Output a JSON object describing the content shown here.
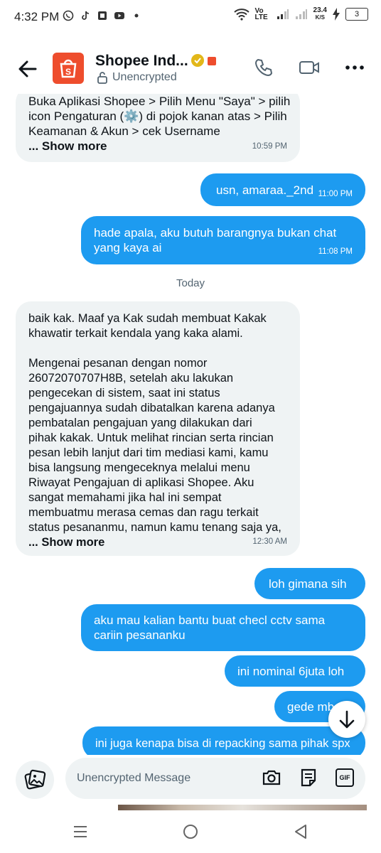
{
  "status": {
    "time": "4:32 PM",
    "network_speed_value": "23.4",
    "network_speed_unit": "K/S",
    "volte": "Vo LTE",
    "battery": "3"
  },
  "header": {
    "name": "Shopee Ind...",
    "subtitle": "Unencrypted"
  },
  "messages": [
    {
      "dir": "in",
      "lines": [
        "Buka Aplikasi Shopee > Pilih Menu \"Saya\" > pilih",
        "icon Pengaturan (⚙️) di pojok kanan atas > Pilih",
        "Keamanan & Akun > cek Username"
      ],
      "more": "... Show more",
      "time": "10:59 PM"
    },
    {
      "dir": "out",
      "text": "usn, amaraa._2nd",
      "time": "11:00 PM"
    },
    {
      "dir": "out",
      "lines": [
        "hade apala, aku butuh barangnya bukan chat",
        "yang kaya ai"
      ],
      "time": "11:08 PM"
    },
    {
      "dir": "in",
      "lines": [
        "baik kak. Maaf ya Kak sudah membuat Kakak",
        "khawatir terkait kendala yang kaka alami.",
        "",
        "Mengenai pesanan dengan nomor",
        "26072070707H8B, setelah aku lakukan",
        "pengecekan di sistem, saat ini status",
        "pengajuannya sudah dibatalkan karena adanya",
        "pembatalan pengajuan yang dilakukan dari",
        "pihak kakak. Untuk melihat rincian serta rincian",
        "pesan lebih lanjut dari tim mediasi kami, kamu",
        "bisa langsung mengeceknya melalui menu",
        "Riwayat Pengajuan di aplikasi Shopee. Aku",
        "sangat memahami jika hal ini sempat",
        "membuatmu merasa cemas dan ragu terkait",
        "status pesananmu, namun kamu tenang saja ya,"
      ],
      "more": "... Show more",
      "time": "12:30 AM"
    },
    {
      "dir": "out",
      "text": "loh gimana sih"
    },
    {
      "dir": "out",
      "lines": [
        "aku mau kalian bantu buat checl cctv sama",
        "cariin pesananku"
      ]
    },
    {
      "dir": "out",
      "text": "ini nominal 6juta loh"
    },
    {
      "dir": "out",
      "text": "gede mb"
    },
    {
      "dir": "out",
      "text": "ini juga kenapa bisa di repacking sama pihak spx"
    }
  ],
  "day_divider": "Today",
  "composer": {
    "placeholder": "Unencrypted Message",
    "gif_label": "GIF"
  },
  "colors": {
    "accent": "#1d9bf0",
    "incoming_bg": "#eff3f4",
    "shopee": "#ee4d2d"
  },
  "icons": [
    "back-arrow-icon",
    "phone-icon",
    "video-icon",
    "more-icon",
    "camera-icon",
    "note-icon",
    "gif-icon",
    "scroll-down-icon",
    "media-icon"
  ]
}
